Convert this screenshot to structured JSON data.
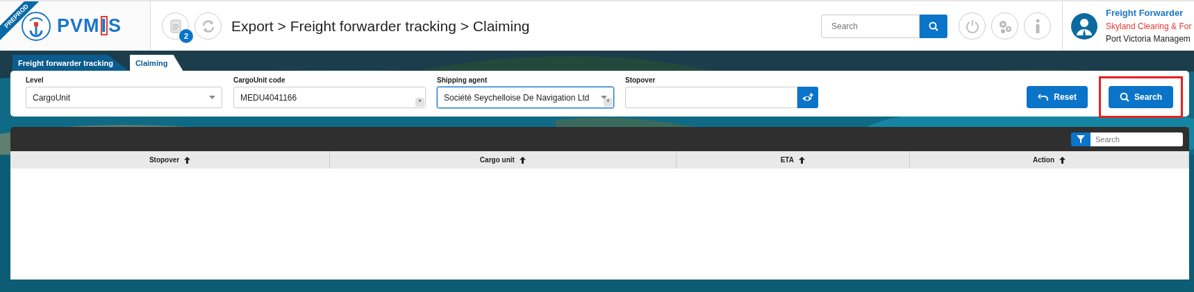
{
  "ribbon": "PREPROD",
  "logo": {
    "text": "PVMIS"
  },
  "header": {
    "notification_count": "2",
    "breadcrumb": "Export > Freight forwarder tracking > Claiming",
    "search": {
      "placeholder": "Search"
    }
  },
  "user": {
    "role": "Freight Forwarder",
    "company": "Skyland Clearing & For",
    "organization": "Port Victoria Managem"
  },
  "tabs": [
    {
      "label": "Freight forwarder tracking",
      "selected": false
    },
    {
      "label": "Claiming",
      "selected": true
    }
  ],
  "filters": [
    {
      "kind": "select",
      "label": "Level",
      "value": "CargoUnit",
      "focused": false
    },
    {
      "kind": "text",
      "label": "CargoUnit code",
      "value": "MEDU4041166",
      "badge": "*",
      "focused": false
    },
    {
      "kind": "select",
      "label": "Shipping agent",
      "value": "Société Seychelloise De Navigation Ltd",
      "badge": "*",
      "focused": true
    },
    {
      "kind": "lookup",
      "label": "Stopover",
      "focused": false
    }
  ],
  "buttons": [
    {
      "kind": "reset",
      "label": "Reset",
      "highlighted": false
    },
    {
      "kind": "search",
      "label": "Search",
      "highlighted": true
    }
  ],
  "table": {
    "search": {
      "placeholder": "Search"
    },
    "columns": [
      {
        "label": "Stopover"
      },
      {
        "label": "Cargo unit"
      },
      {
        "label": "ETA"
      },
      {
        "label": "Action"
      }
    ]
  }
}
